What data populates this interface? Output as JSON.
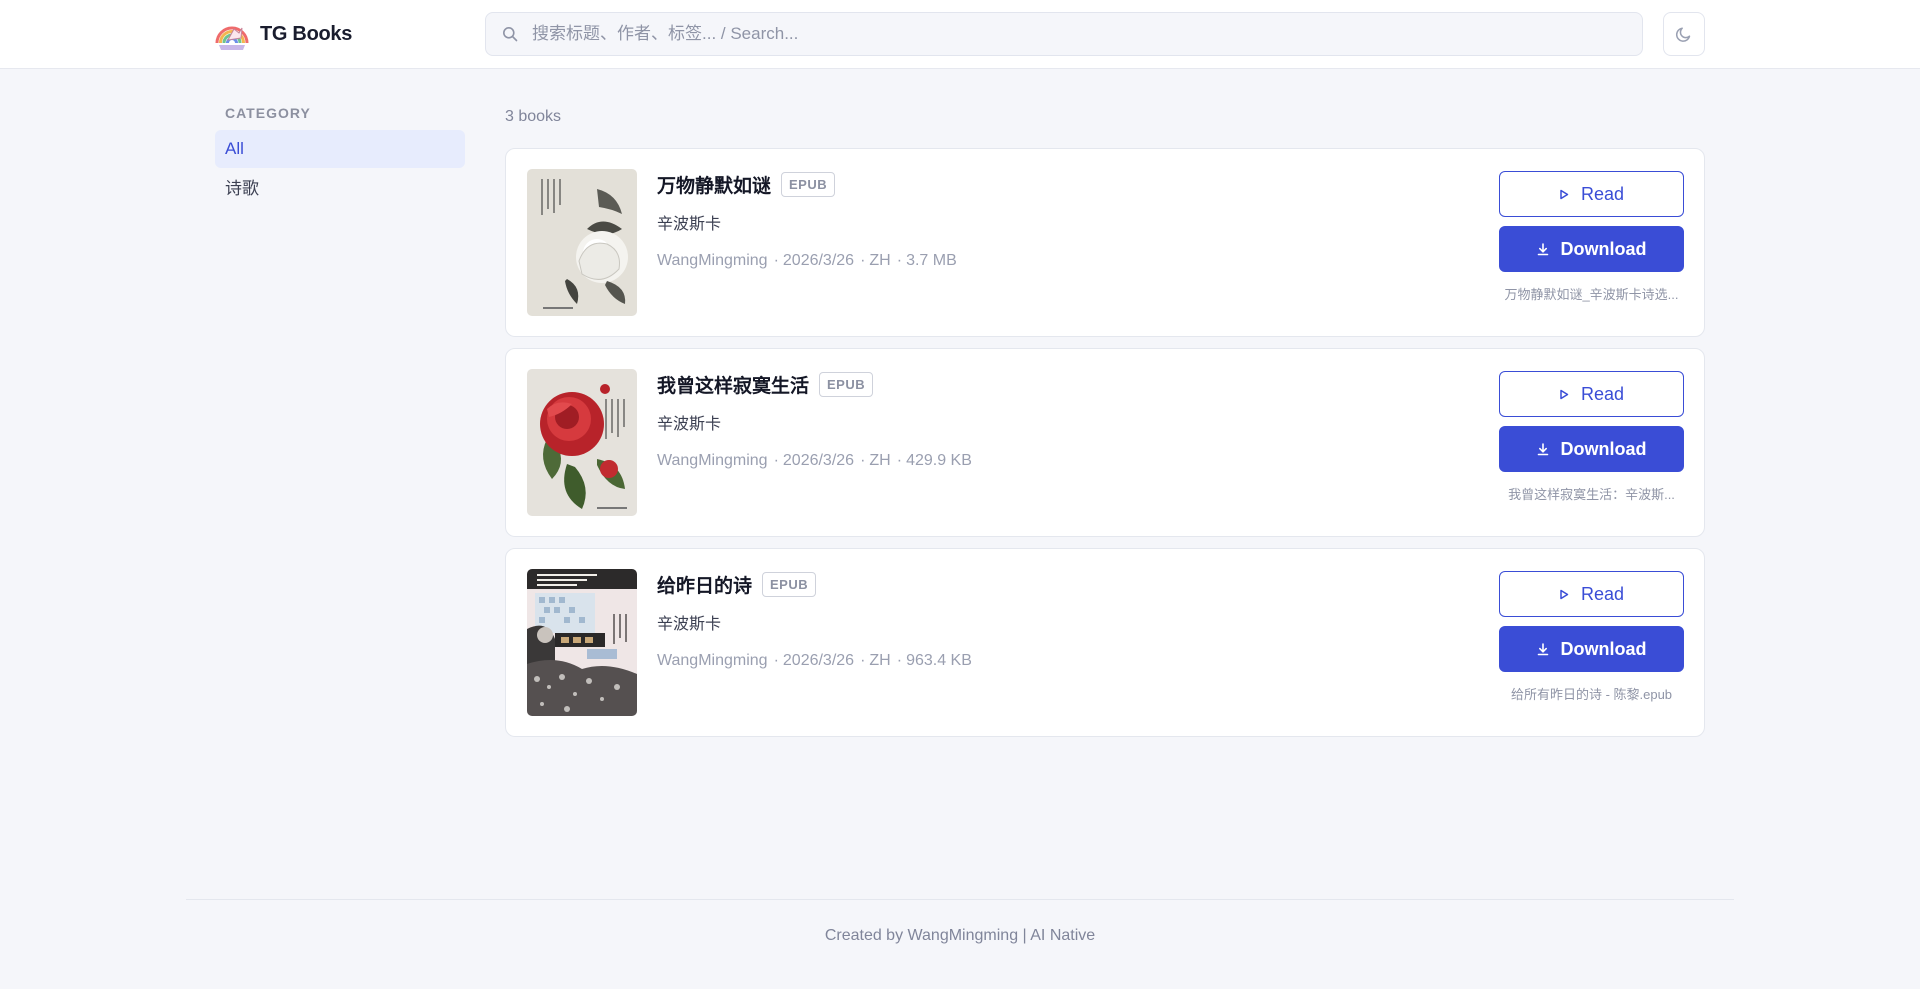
{
  "app": {
    "name": "TG Books",
    "logo_icon": "rainbow-unicorn-logo"
  },
  "search": {
    "placeholder": "搜索标题、作者、标签... / Search..."
  },
  "theme_toggle": {
    "icon": "moon-icon"
  },
  "sidebar": {
    "heading": "CATEGORY",
    "items": [
      {
        "label": "All",
        "active": true
      },
      {
        "label": "诗歌",
        "active": false
      }
    ]
  },
  "results": {
    "count_label": "3 books"
  },
  "books": [
    {
      "title": "万物静默如谜",
      "format": "EPUB",
      "author": "辛波斯卡",
      "uploader": "WangMingming",
      "date": "2026/3/26",
      "lang": "ZH",
      "size": "3.7 MB",
      "read_label": "Read",
      "download_label": "Download",
      "filename": "万物静默如谜_辛波斯卡诗选..."
    },
    {
      "title": "我曾这样寂寞生活",
      "format": "EPUB",
      "author": "辛波斯卡",
      "uploader": "WangMingming",
      "date": "2026/3/26",
      "lang": "ZH",
      "size": "429.9 KB",
      "read_label": "Read",
      "download_label": "Download",
      "filename": "我曾这样寂寞生活：辛波斯..."
    },
    {
      "title": "给昨日的诗",
      "format": "EPUB",
      "author": "辛波斯卡",
      "uploader": "WangMingming",
      "date": "2026/3/26",
      "lang": "ZH",
      "size": "963.4 KB",
      "read_label": "Read",
      "download_label": "Download",
      "filename": "给所有昨日的诗 - 陈黎.epub"
    }
  ],
  "footer": {
    "text": "Created by WangMingming | AI Native"
  },
  "colors": {
    "accent": "#3a4dd6",
    "background": "#f5f6fa",
    "card": "#ffffff",
    "active_bg": "#e7ecfd"
  }
}
